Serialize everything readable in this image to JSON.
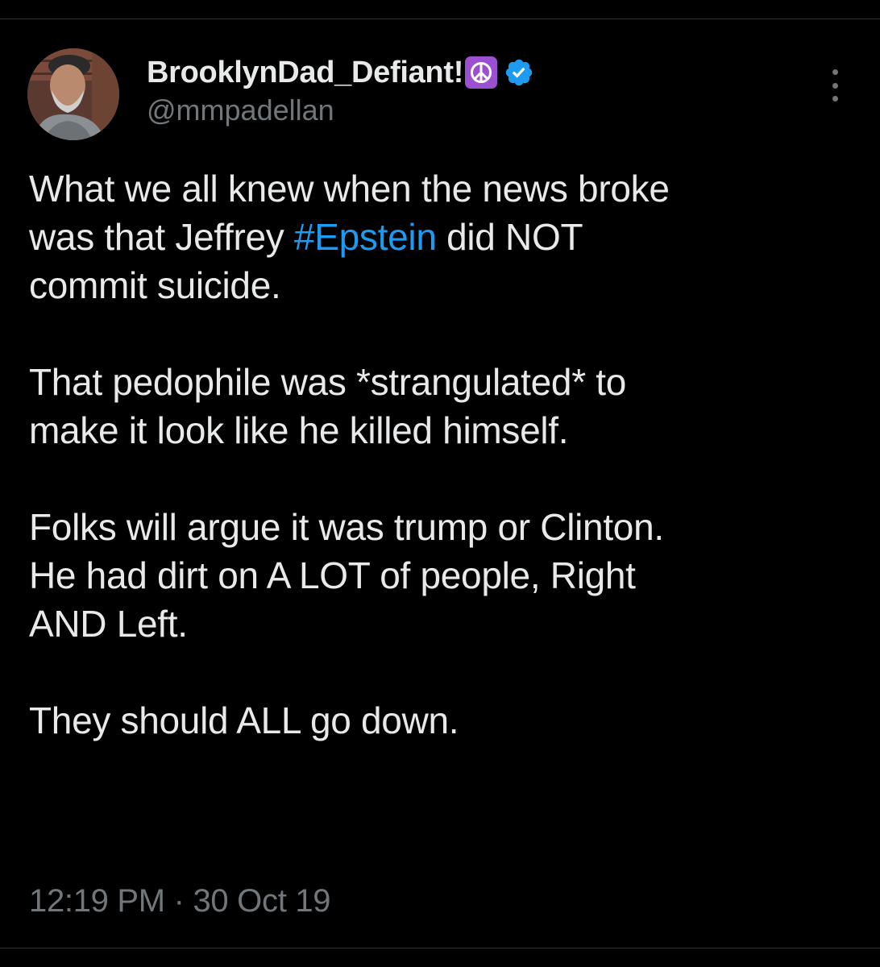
{
  "author": {
    "display_name": "BrooklynDad_Defiant!",
    "emoji_badge": "peace-symbol-icon",
    "verified_badge": "verified-badge-icon",
    "handle": "@mmpadellan"
  },
  "more_icon": "more-options-icon",
  "tweet": {
    "paragraphs": [
      {
        "lines": [
          "What we all knew when the news broke",
          {
            "before": "was that Jeffrey ",
            "hashtag": "#Epstein",
            "after": " did NOT"
          },
          "commit suicide."
        ]
      },
      {
        "lines": [
          "That pedophile was *strangulated* to",
          "make it look like he killed himself."
        ]
      },
      {
        "lines": [
          "Folks will argue it was trump or Clinton.",
          "He had dirt on A LOT of people, Right",
          "AND Left."
        ]
      },
      {
        "lines": [
          "They should ALL go down."
        ]
      }
    ]
  },
  "timestamp": {
    "time": "12:19 PM",
    "separator": " · ",
    "date": "30 Oct 19"
  },
  "colors": {
    "background": "#000000",
    "text": "#e7e9ea",
    "secondary_text": "#71767b",
    "link": "#1d9bf0",
    "verified": "#1d9bf0",
    "emoji_bg": "#9b4fd1",
    "divider": "#2f3336"
  }
}
